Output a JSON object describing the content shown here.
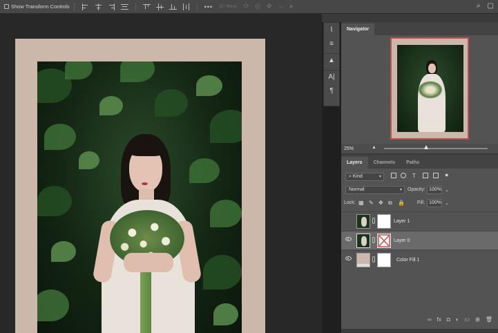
{
  "options_bar": {
    "show_transform_label": "Show Transform Controls",
    "more_label": "•••",
    "mode_3d_label": "3D Mode",
    "align_icons": [
      "align-left-edges-icon",
      "align-horizontal-centers-icon",
      "align-right-edges-icon",
      "distribute-icon",
      "align-top-edges-icon",
      "align-vertical-centers-icon",
      "align-bottom-edges-icon",
      "distribute-vertical-icon"
    ],
    "right_icons": [
      "search-icon",
      "workspace-icon"
    ]
  },
  "strip_icons": [
    "brush-settings-icon",
    "adjustments-icon",
    "histogram-icon",
    "character-icon",
    "paragraph-icon"
  ],
  "strip_glyphs": {
    "char": "A|",
    "para": "¶"
  },
  "navigator": {
    "tab": "Navigator",
    "zoom": "25%",
    "slider_fraction": 0.41
  },
  "layers_panel": {
    "tabs": [
      "Layers",
      "Channels",
      "Paths"
    ],
    "filter_kind": "Kind",
    "blend_mode": "Normal",
    "opacity_label": "Opacity:",
    "opacity_value": "100%",
    "lock_label": "Lock:",
    "fill_label": "Fill:",
    "fill_value": "100%",
    "layers": [
      {
        "name": "Layer 1",
        "visible": false,
        "selected": false
      },
      {
        "name": "Layer 0",
        "visible": true,
        "selected": true
      },
      {
        "name": "Color Fill 1",
        "visible": true,
        "selected": false
      }
    ],
    "footer_icons": [
      "link-icon",
      "fx-icon",
      "mask-icon",
      "adjustment-layer-icon",
      "group-icon",
      "new-layer-icon",
      "trash-icon"
    ],
    "footer_glyphs": [
      "∞",
      "fx",
      "◘",
      "◐",
      "▭",
      "⊞",
      "🗑"
    ]
  },
  "colors": {
    "frame_fill": "#cbb8aa",
    "selected_outline": "#c0504d"
  }
}
